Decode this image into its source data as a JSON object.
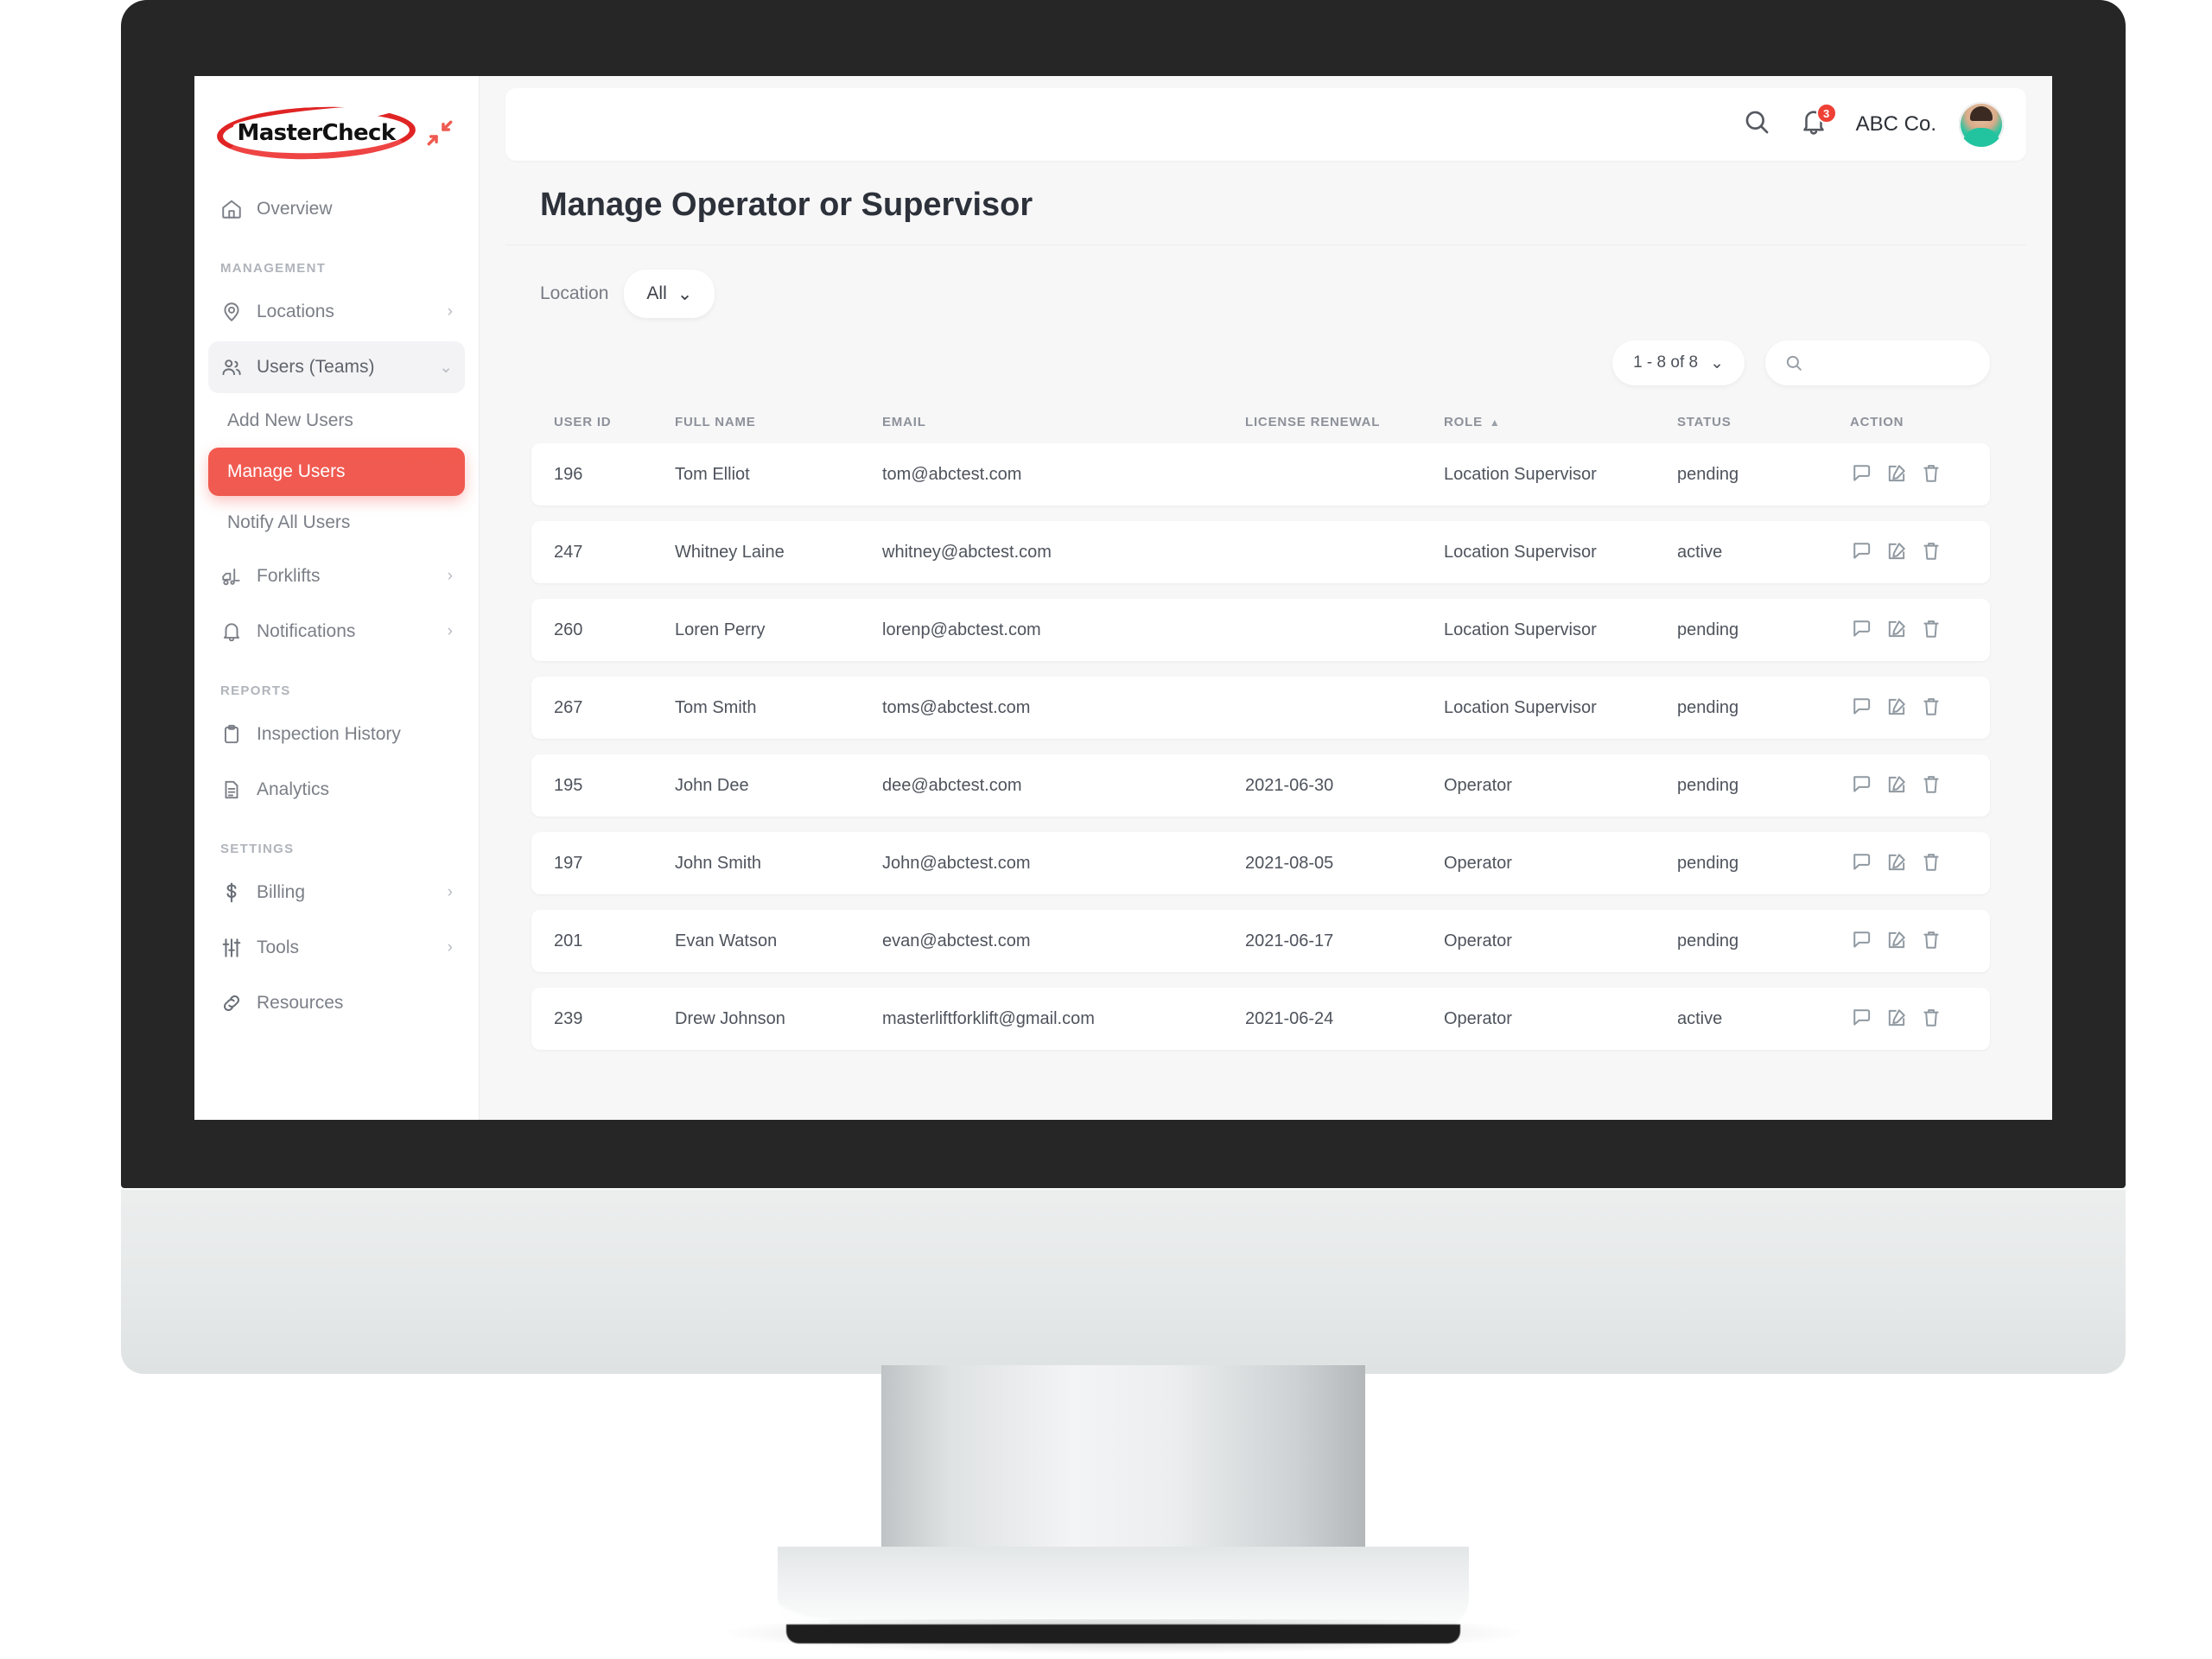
{
  "brand": {
    "logo_text": "MasterCheck",
    "accent_color": "#ef5b51",
    "logo_ring_color": "#e02424",
    "collapse_icon": "collapse-arrows-icon"
  },
  "sidebar": {
    "primary": [
      {
        "icon": "home-icon",
        "label": "Overview",
        "chevron": ""
      }
    ],
    "sections": [
      {
        "title": "MANAGEMENT",
        "items": [
          {
            "icon": "location-pin-icon",
            "label": "Locations",
            "chevron": "›"
          },
          {
            "icon": "users-icon",
            "label": "Users (Teams)",
            "chevron": "⌄",
            "expanded": true
          }
        ],
        "subitems": [
          {
            "label": "Add New Users",
            "selected": false
          },
          {
            "label": "Manage Users",
            "selected": true
          },
          {
            "label": "Notify All Users",
            "selected": false
          }
        ],
        "items_after": [
          {
            "icon": "forklift-icon",
            "label": "Forklifts",
            "chevron": "›"
          },
          {
            "icon": "bell-icon",
            "label": "Notifications",
            "chevron": "›"
          }
        ]
      },
      {
        "title": "REPORTS",
        "items": [
          {
            "icon": "clipboard-icon",
            "label": "Inspection History",
            "chevron": ""
          },
          {
            "icon": "document-icon",
            "label": "Analytics",
            "chevron": ""
          }
        ]
      },
      {
        "title": "SETTINGS",
        "items": [
          {
            "icon": "dollar-icon",
            "label": "Billing",
            "chevron": "›"
          },
          {
            "icon": "sliders-icon",
            "label": "Tools",
            "chevron": "›"
          },
          {
            "icon": "link-icon",
            "label": "Resources",
            "chevron": ""
          }
        ]
      }
    ]
  },
  "topbar": {
    "search_icon": "search-icon",
    "bell_icon": "bell-icon",
    "notification_count": "3",
    "company": "ABC Co.",
    "avatar": "user-avatar"
  },
  "page": {
    "title": "Manage Operator or Supervisor"
  },
  "filters": {
    "location_label": "Location",
    "location_value": "All",
    "location_chevron": "⌄"
  },
  "toolbar": {
    "pager_text": "1 - 8 of 8",
    "pager_chevron": "⌄",
    "search_placeholder": "",
    "search_value": ""
  },
  "table": {
    "columns": [
      {
        "key": "id",
        "label": "USER ID"
      },
      {
        "key": "name",
        "label": "FULL NAME"
      },
      {
        "key": "email",
        "label": "EMAIL"
      },
      {
        "key": "license",
        "label": "LICENSE RENEWAL"
      },
      {
        "key": "role",
        "label": "ROLE",
        "sorted": "asc",
        "sort_glyph": "▲"
      },
      {
        "key": "status",
        "label": "STATUS"
      },
      {
        "key": "action",
        "label": "ACTION"
      }
    ],
    "action_icons": [
      "comment-icon",
      "edit-icon",
      "delete-icon"
    ],
    "rows": [
      {
        "id": "196",
        "name": "Tom Elliot",
        "email": "tom@abctest.com",
        "license": "",
        "role": "Location Supervisor",
        "status": "pending"
      },
      {
        "id": "247",
        "name": "Whitney Laine",
        "email": "whitney@abctest.com",
        "license": "",
        "role": "Location Supervisor",
        "status": "active"
      },
      {
        "id": "260",
        "name": "Loren Perry",
        "email": "lorenp@abctest.com",
        "license": "",
        "role": "Location Supervisor",
        "status": "pending"
      },
      {
        "id": "267",
        "name": "Tom Smith",
        "email": "toms@abctest.com",
        "license": "",
        "role": "Location Supervisor",
        "status": "pending"
      },
      {
        "id": "195",
        "name": "John Dee",
        "email": "dee@abctest.com",
        "license": "2021-06-30",
        "role": "Operator",
        "status": "pending"
      },
      {
        "id": "197",
        "name": "John Smith",
        "email": "John@abctest.com",
        "license": "2021-08-05",
        "role": "Operator",
        "status": "pending"
      },
      {
        "id": "201",
        "name": "Evan Watson",
        "email": "evan@abctest.com",
        "license": "2021-06-17",
        "role": "Operator",
        "status": "pending"
      },
      {
        "id": "239",
        "name": "Drew Johnson",
        "email": "masterliftforklift@gmail.com",
        "license": "2021-06-24",
        "role": "Operator",
        "status": "active"
      }
    ]
  }
}
